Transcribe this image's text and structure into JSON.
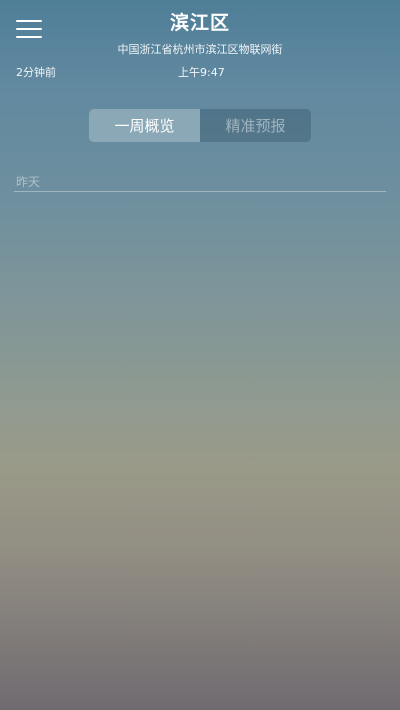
{
  "header": {
    "menu_icon": "hamburger-menu-icon",
    "title": "滨江区",
    "address": "中国浙江省杭州市滨江区物联网街",
    "updated_ago": "2分钟前",
    "publish_time": "上午9:47"
  },
  "tabs": [
    {
      "label": "一周概览",
      "active": true
    },
    {
      "label": "精准预报",
      "active": false
    }
  ],
  "main": {
    "section_label": "昨天"
  }
}
